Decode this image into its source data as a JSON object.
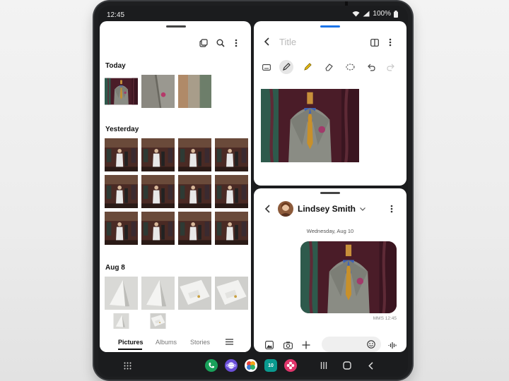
{
  "status": {
    "time": "12:45",
    "battery": "100%"
  },
  "gallery": {
    "sections": [
      {
        "title": "Today"
      },
      {
        "title": "Yesterday"
      },
      {
        "title": "Aug 8"
      }
    ],
    "tabs": [
      "Pictures",
      "Albums",
      "Stories"
    ],
    "active_tab": "Pictures"
  },
  "notes": {
    "title_placeholder": "Title"
  },
  "messages": {
    "contact": "Lindsey Smith",
    "date": "Wednesday, Aug 10",
    "meta": "MMS 12:45"
  },
  "dock": {
    "apps": [
      "phone",
      "internet",
      "gallery",
      "calendar",
      "flower"
    ],
    "colors": {
      "phone": "#19a05a",
      "internet": "#6a4fd8",
      "calendar": "#0a9a8f",
      "flower": "#e0356b"
    }
  },
  "colors": {
    "accent": "#1a73e8",
    "dark": "#1b1c1e"
  }
}
